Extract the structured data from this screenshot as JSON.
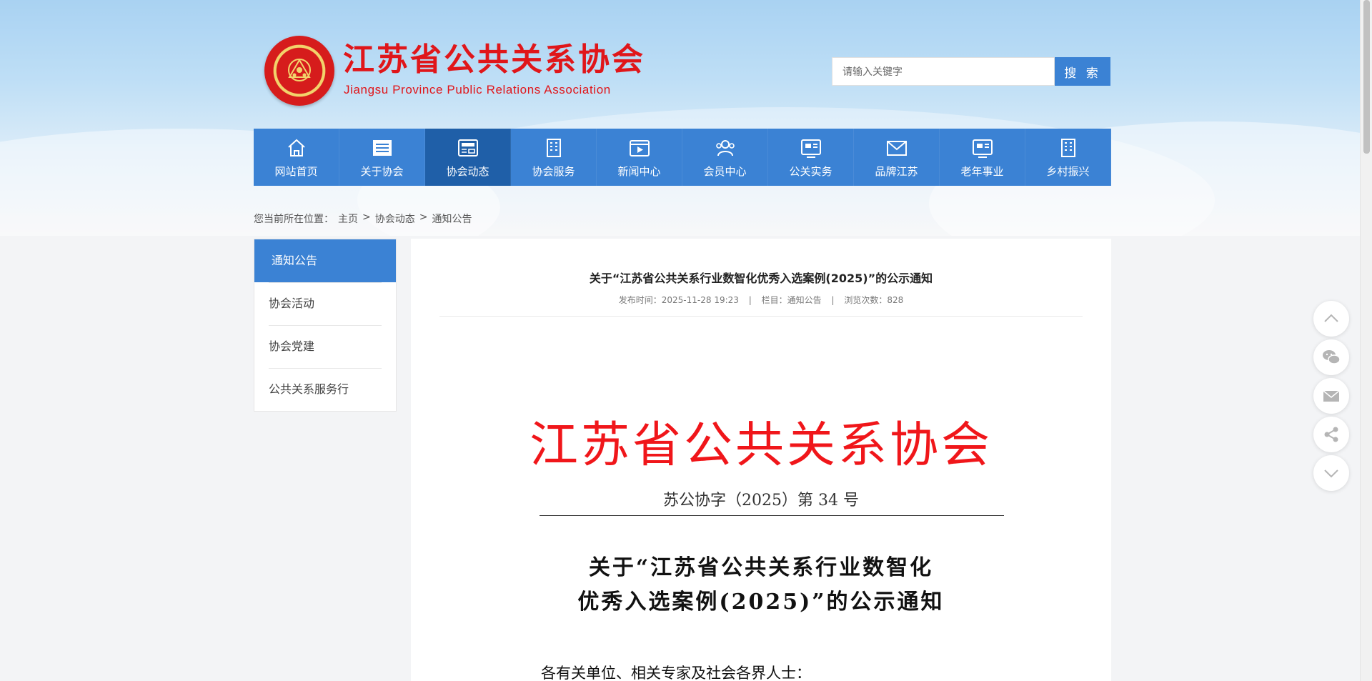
{
  "header": {
    "title": "江苏省公共关系协会",
    "subtitle": "Jiangsu Province Public Relations Association",
    "logo_text": "江苏省公共关系协会"
  },
  "search": {
    "placeholder": "请输入关键字",
    "button_label": "搜 索"
  },
  "colors": {
    "primary": "#3b82d4",
    "primary_active": "#1f5fa8",
    "brand_red": "#e0161a"
  },
  "nav": {
    "items": [
      {
        "label": "网站首页",
        "icon": "home-icon"
      },
      {
        "label": "关于协会",
        "icon": "document-icon"
      },
      {
        "label": "协会动态",
        "icon": "news-icon",
        "active": true
      },
      {
        "label": "协会服务",
        "icon": "building-icon"
      },
      {
        "label": "新闻中心",
        "icon": "video-icon"
      },
      {
        "label": "会员中心",
        "icon": "members-icon"
      },
      {
        "label": "公关实务",
        "icon": "card-icon"
      },
      {
        "label": "品牌江苏",
        "icon": "mail-icon"
      },
      {
        "label": "老年事业",
        "icon": "card-icon"
      },
      {
        "label": "乡村振兴",
        "icon": "building-icon"
      }
    ]
  },
  "breadcrumb": {
    "prefix": "您当前所在位置：",
    "items": [
      "主页",
      "协会动态",
      "通知公告"
    ],
    "separator": ">"
  },
  "sidebar": {
    "items": [
      {
        "label": "通知公告",
        "active": true
      },
      {
        "label": "协会活动"
      },
      {
        "label": "协会党建"
      },
      {
        "label": "公共关系服务行"
      }
    ]
  },
  "article": {
    "title": "关于“江苏省公共关系行业数智化优秀入选案例(2025)”的公示通知",
    "meta": {
      "publish_time": "发布时间：2025-11-28 19:23",
      "column": "栏目：通知公告",
      "views": "浏览次数：828",
      "separator": "|"
    },
    "doc": {
      "issuer": "江苏省公共关系协会",
      "number": "苏公协字（2025）第 34 号",
      "title_line1": "关于“江苏省公共关系行业数智化",
      "title_line2": "优秀入选案例(2025)”的公示通知",
      "greeting": "各有关单位、相关专家及社会各界人士："
    }
  },
  "float_tools": [
    "arrow-up-icon",
    "wechat-icon",
    "email-icon",
    "share-icon",
    "arrow-down-icon"
  ]
}
